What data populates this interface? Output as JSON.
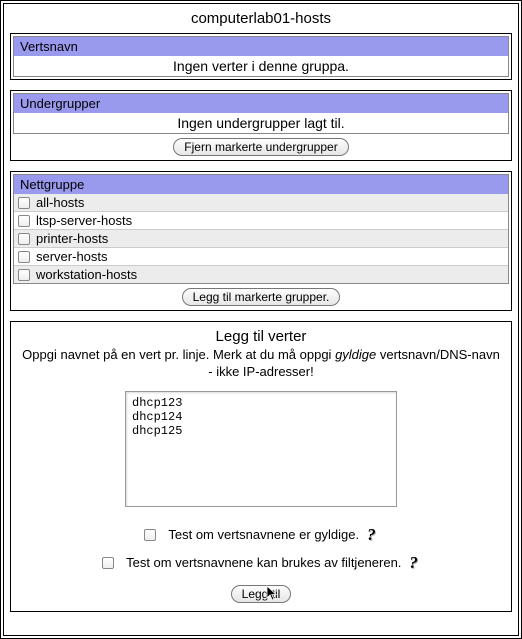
{
  "title": "computerlab01-hosts",
  "hostname_section": {
    "header": "Vertsnavn",
    "message": "Ingen verter i denne gruppa."
  },
  "subgroups_section": {
    "header": "Undergrupper",
    "message": "Ingen undergrupper lagt til.",
    "remove_button": "Fjern markerte undergrupper"
  },
  "netgroup_section": {
    "header": "Nettgruppe",
    "items": [
      "all-hosts",
      "ltsp-server-hosts",
      "printer-hosts",
      "server-hosts",
      "workstation-hosts"
    ],
    "add_button": "Legg til markerte grupper."
  },
  "add_hosts_section": {
    "title": "Legg til verter",
    "instruction_pre": "Oppgi navnet på en vert pr. linje. Merk at du må oppgi ",
    "instruction_em": "gyldige",
    "instruction_post": " vertsnavn/DNS-navn - ikke IP-adresser!",
    "textarea_value": "dhcp123\ndhcp124\ndhcp125",
    "check_valid": "Test om vertsnavnene er gyldige.",
    "check_fileserver": "Test om vertsnavnene kan brukes av filtjeneren.",
    "help": "?",
    "submit_button": "Legg til"
  }
}
